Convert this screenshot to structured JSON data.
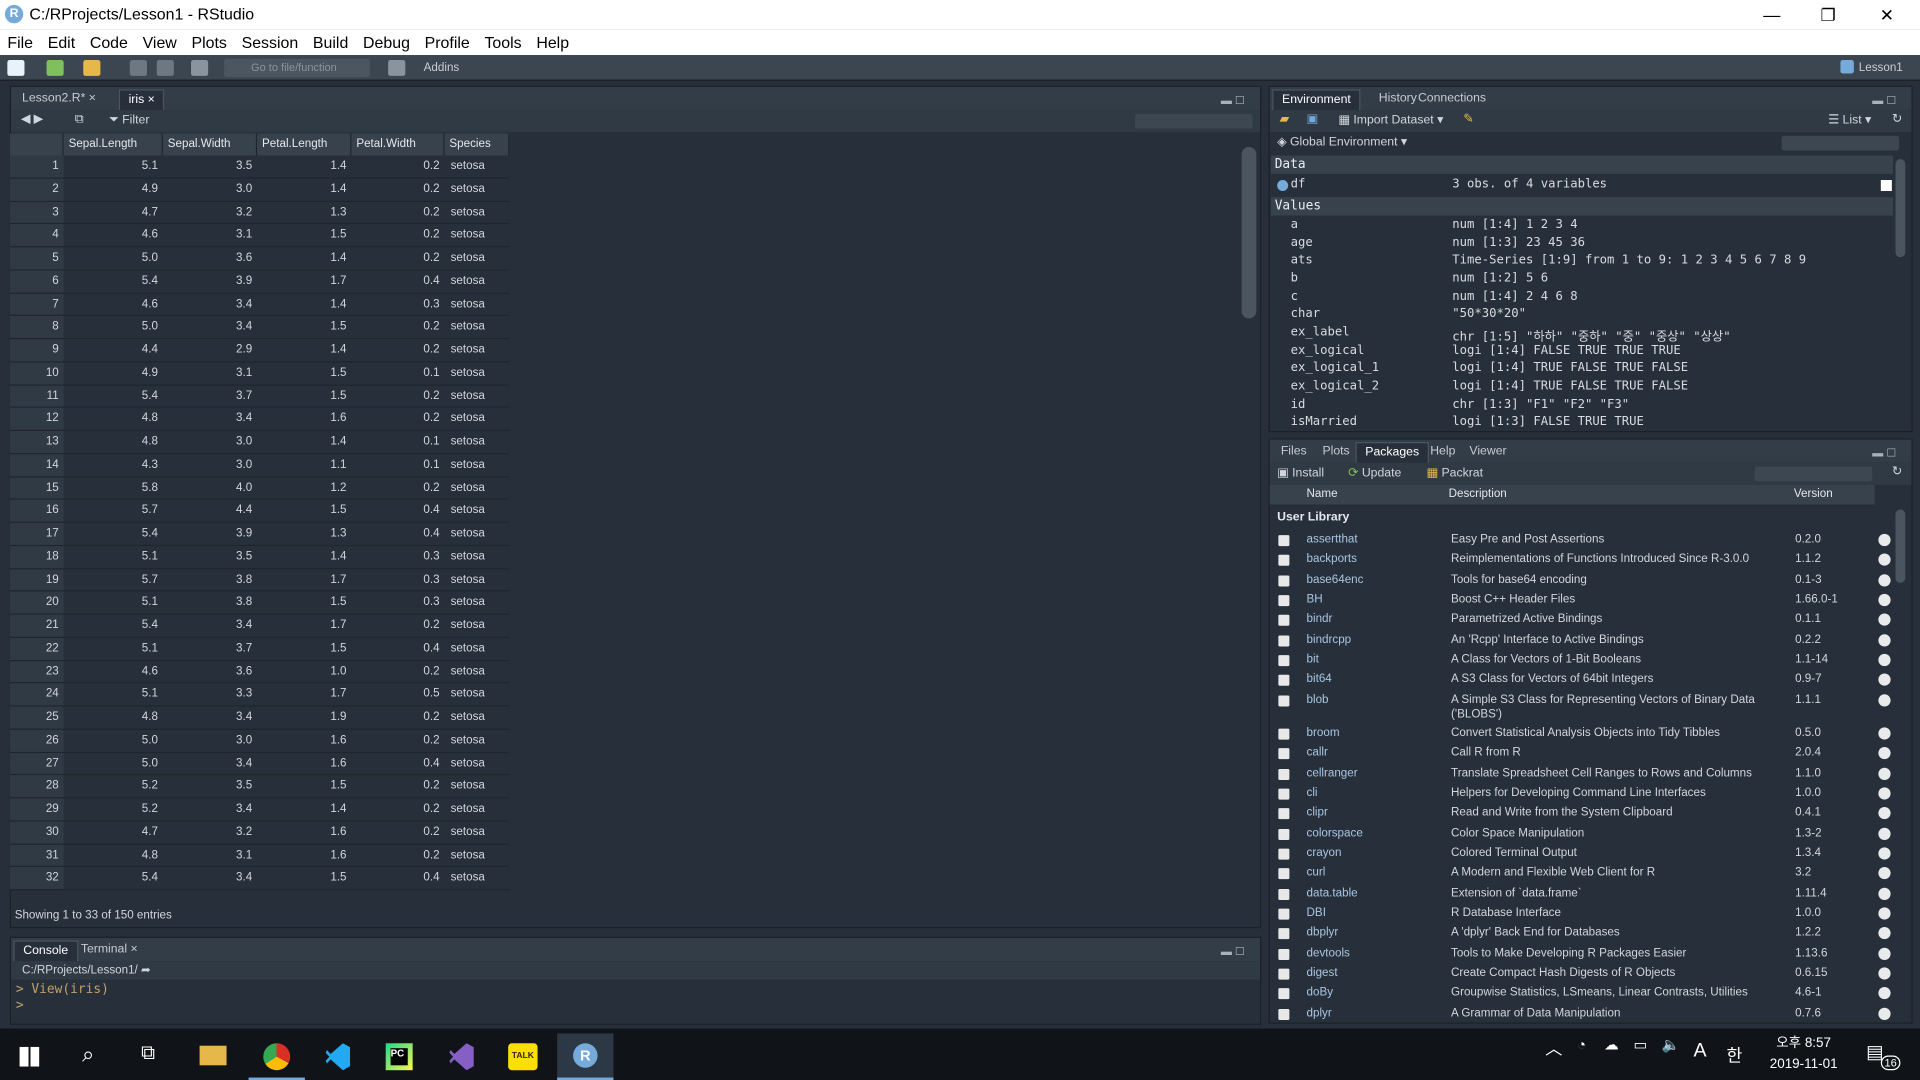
{
  "window": {
    "title": "C:/RProjects/Lesson1 - RStudio",
    "minimize": "—",
    "restore": "❐",
    "close": "✕"
  },
  "menu": [
    "File",
    "Edit",
    "Code",
    "View",
    "Plots",
    "Session",
    "Build",
    "Debug",
    "Profile",
    "Tools",
    "Help"
  ],
  "toolbar": {
    "goto_placeholder": "Go to file/function",
    "addins": "Addins",
    "project": "Lesson1"
  },
  "source": {
    "tabs": [
      {
        "label": "Lesson2.R*"
      },
      {
        "label": "iris"
      }
    ],
    "filter_label": "Filter",
    "columns": [
      "",
      "Sepal.Length",
      "Sepal.Width",
      "Petal.Length",
      "Petal.Width",
      "Species"
    ],
    "rows": [
      [
        "1",
        "5.1",
        "3.5",
        "1.4",
        "0.2",
        "setosa"
      ],
      [
        "2",
        "4.9",
        "3.0",
        "1.4",
        "0.2",
        "setosa"
      ],
      [
        "3",
        "4.7",
        "3.2",
        "1.3",
        "0.2",
        "setosa"
      ],
      [
        "4",
        "4.6",
        "3.1",
        "1.5",
        "0.2",
        "setosa"
      ],
      [
        "5",
        "5.0",
        "3.6",
        "1.4",
        "0.2",
        "setosa"
      ],
      [
        "6",
        "5.4",
        "3.9",
        "1.7",
        "0.4",
        "setosa"
      ],
      [
        "7",
        "4.6",
        "3.4",
        "1.4",
        "0.3",
        "setosa"
      ],
      [
        "8",
        "5.0",
        "3.4",
        "1.5",
        "0.2",
        "setosa"
      ],
      [
        "9",
        "4.4",
        "2.9",
        "1.4",
        "0.2",
        "setosa"
      ],
      [
        "10",
        "4.9",
        "3.1",
        "1.5",
        "0.1",
        "setosa"
      ],
      [
        "11",
        "5.4",
        "3.7",
        "1.5",
        "0.2",
        "setosa"
      ],
      [
        "12",
        "4.8",
        "3.4",
        "1.6",
        "0.2",
        "setosa"
      ],
      [
        "13",
        "4.8",
        "3.0",
        "1.4",
        "0.1",
        "setosa"
      ],
      [
        "14",
        "4.3",
        "3.0",
        "1.1",
        "0.1",
        "setosa"
      ],
      [
        "15",
        "5.8",
        "4.0",
        "1.2",
        "0.2",
        "setosa"
      ],
      [
        "16",
        "5.7",
        "4.4",
        "1.5",
        "0.4",
        "setosa"
      ],
      [
        "17",
        "5.4",
        "3.9",
        "1.3",
        "0.4",
        "setosa"
      ],
      [
        "18",
        "5.1",
        "3.5",
        "1.4",
        "0.3",
        "setosa"
      ],
      [
        "19",
        "5.7",
        "3.8",
        "1.7",
        "0.3",
        "setosa"
      ],
      [
        "20",
        "5.1",
        "3.8",
        "1.5",
        "0.3",
        "setosa"
      ],
      [
        "21",
        "5.4",
        "3.4",
        "1.7",
        "0.2",
        "setosa"
      ],
      [
        "22",
        "5.1",
        "3.7",
        "1.5",
        "0.4",
        "setosa"
      ],
      [
        "23",
        "4.6",
        "3.6",
        "1.0",
        "0.2",
        "setosa"
      ],
      [
        "24",
        "5.1",
        "3.3",
        "1.7",
        "0.5",
        "setosa"
      ],
      [
        "25",
        "4.8",
        "3.4",
        "1.9",
        "0.2",
        "setosa"
      ],
      [
        "26",
        "5.0",
        "3.0",
        "1.6",
        "0.2",
        "setosa"
      ],
      [
        "27",
        "5.0",
        "3.4",
        "1.6",
        "0.4",
        "setosa"
      ],
      [
        "28",
        "5.2",
        "3.5",
        "1.5",
        "0.2",
        "setosa"
      ],
      [
        "29",
        "5.2",
        "3.4",
        "1.4",
        "0.2",
        "setosa"
      ],
      [
        "30",
        "4.7",
        "3.2",
        "1.6",
        "0.2",
        "setosa"
      ],
      [
        "31",
        "4.8",
        "3.1",
        "1.6",
        "0.2",
        "setosa"
      ],
      [
        "32",
        "5.4",
        "3.4",
        "1.5",
        "0.4",
        "setosa"
      ]
    ],
    "status": "Showing 1 to 33 of 150 entries"
  },
  "console": {
    "tabs": [
      {
        "label": "Console"
      },
      {
        "label": "Terminal"
      }
    ],
    "path": "C:/RProjects/Lesson1/",
    "lines": [
      "> View(iris)",
      ">"
    ]
  },
  "environment": {
    "tabs": [
      {
        "label": "Environment"
      },
      {
        "label": "History"
      },
      {
        "label": "Connections"
      }
    ],
    "import_label": "Import Dataset",
    "list_label": "List",
    "scope": "Global Environment",
    "data_header": "Data",
    "data": [
      {
        "name": "df",
        "value": "3 obs. of 4 variables"
      }
    ],
    "values_header": "Values",
    "values": [
      {
        "name": "a",
        "value": "num [1:4] 1 2 3 4"
      },
      {
        "name": "age",
        "value": "num [1:3] 23 45 36"
      },
      {
        "name": "ats",
        "value": "Time-Series [1:9] from 1 to 9: 1 2 3 4 5 6 7 8 9"
      },
      {
        "name": "b",
        "value": "num [1:2] 5 6"
      },
      {
        "name": "c",
        "value": "num [1:4] 2 4 6 8"
      },
      {
        "name": "char",
        "value": "\"50*30*20\""
      },
      {
        "name": "ex_label",
        "value": "chr [1:5] \"하하\" \"중하\" \"중\" \"중상\" \"상상\""
      },
      {
        "name": "ex_logical",
        "value": "logi [1:4] FALSE TRUE TRUE TRUE"
      },
      {
        "name": "ex_logical_1",
        "value": "logi [1:4] TRUE FALSE TRUE FALSE"
      },
      {
        "name": "ex_logical_2",
        "value": "logi [1:4] TRUE FALSE TRUE FALSE"
      },
      {
        "name": "id",
        "value": "chr [1:3] \"F1\" \"F2\" \"F3\""
      },
      {
        "name": "isMarried",
        "value": "logi [1:3] FALSE TRUE TRUE"
      }
    ]
  },
  "packages": {
    "tabs": [
      {
        "label": "Files"
      },
      {
        "label": "Plots"
      },
      {
        "label": "Packages"
      },
      {
        "label": "Help"
      },
      {
        "label": "Viewer"
      }
    ],
    "install_label": "Install",
    "update_label": "Update",
    "packrat_label": "Packrat",
    "columns": [
      "Name",
      "Description",
      "Version"
    ],
    "library_label": "User Library",
    "items": [
      {
        "name": "assertthat",
        "desc": "Easy Pre and Post Assertions",
        "ver": "0.2.0"
      },
      {
        "name": "backports",
        "desc": "Reimplementations of Functions Introduced Since R-3.0.0",
        "ver": "1.1.2"
      },
      {
        "name": "base64enc",
        "desc": "Tools for base64 encoding",
        "ver": "0.1-3"
      },
      {
        "name": "BH",
        "desc": "Boost C++ Header Files",
        "ver": "1.66.0-1"
      },
      {
        "name": "bindr",
        "desc": "Parametrized Active Bindings",
        "ver": "0.1.1"
      },
      {
        "name": "bindrcpp",
        "desc": "An 'Rcpp' Interface to Active Bindings",
        "ver": "0.2.2"
      },
      {
        "name": "bit",
        "desc": "A Class for Vectors of 1-Bit Booleans",
        "ver": "1.1-14"
      },
      {
        "name": "bit64",
        "desc": "A S3 Class for Vectors of 64bit Integers",
        "ver": "0.9-7"
      },
      {
        "name": "blob",
        "desc": "A Simple S3 Class for Representing Vectors of Binary Data ('BLOBS')",
        "ver": "1.1.1"
      },
      {
        "name": "broom",
        "desc": "Convert Statistical Analysis Objects into Tidy Tibbles",
        "ver": "0.5.0"
      },
      {
        "name": "callr",
        "desc": "Call R from R",
        "ver": "2.0.4"
      },
      {
        "name": "cellranger",
        "desc": "Translate Spreadsheet Cell Ranges to Rows and Columns",
        "ver": "1.1.0"
      },
      {
        "name": "cli",
        "desc": "Helpers for Developing Command Line Interfaces",
        "ver": "1.0.0"
      },
      {
        "name": "clipr",
        "desc": "Read and Write from the System Clipboard",
        "ver": "0.4.1"
      },
      {
        "name": "colorspace",
        "desc": "Color Space Manipulation",
        "ver": "1.3-2"
      },
      {
        "name": "crayon",
        "desc": "Colored Terminal Output",
        "ver": "1.3.4"
      },
      {
        "name": "curl",
        "desc": "A Modern and Flexible Web Client for R",
        "ver": "3.2"
      },
      {
        "name": "data.table",
        "desc": "Extension of `data.frame`",
        "ver": "1.11.4"
      },
      {
        "name": "DBI",
        "desc": "R Database Interface",
        "ver": "1.0.0"
      },
      {
        "name": "dbplyr",
        "desc": "A 'dplyr' Back End for Databases",
        "ver": "1.2.2"
      },
      {
        "name": "devtools",
        "desc": "Tools to Make Developing R Packages Easier",
        "ver": "1.13.6"
      },
      {
        "name": "digest",
        "desc": "Create Compact Hash Digests of R Objects",
        "ver": "0.6.15"
      },
      {
        "name": "doBy",
        "desc": "Groupwise Statistics, LSmeans, Linear Contrasts, Utilities",
        "ver": "4.6-1"
      },
      {
        "name": "dplyr",
        "desc": "A Grammar of Data Manipulation",
        "ver": "0.7.6"
      }
    ]
  },
  "taskbar": {
    "time": "오후 8:57",
    "date": "2019-11-01",
    "ime": "A",
    "lang": "한",
    "notif": "16"
  }
}
